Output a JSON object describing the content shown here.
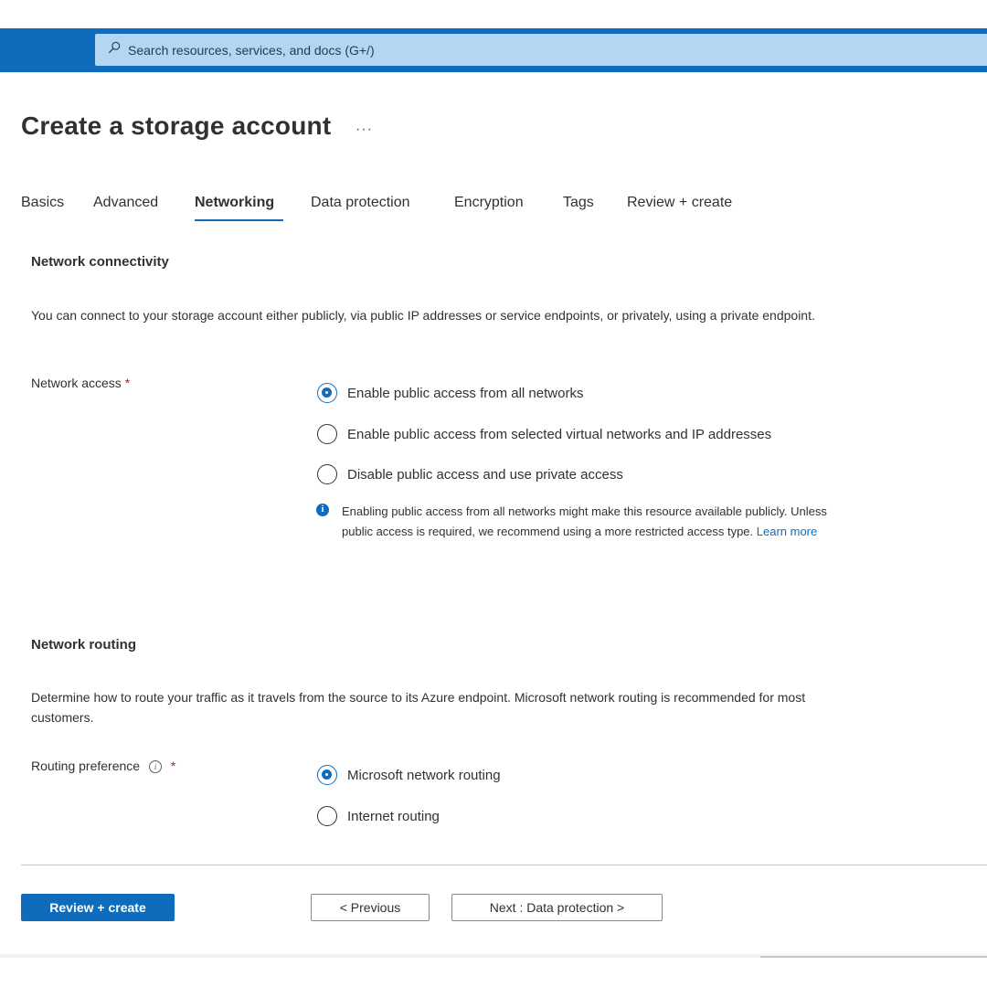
{
  "header": {
    "search_placeholder": "Search resources, services, and docs (G+/)"
  },
  "page": {
    "title": "Create a storage account",
    "more_label": "···"
  },
  "tabs": [
    {
      "label": "Basics",
      "active": false
    },
    {
      "label": "Advanced",
      "active": false
    },
    {
      "label": "Networking",
      "active": true
    },
    {
      "label": "Data protection",
      "active": false
    },
    {
      "label": "Encryption",
      "active": false
    },
    {
      "label": "Tags",
      "active": false
    },
    {
      "label": "Review + create",
      "active": false
    }
  ],
  "network_connectivity": {
    "title": "Network connectivity",
    "description": "You can connect to your storage account either publicly, via public IP addresses or service endpoints, or privately, using a private endpoint.",
    "field_label": "Network access",
    "required_mark": "*",
    "options": [
      {
        "label": "Enable public access from all networks",
        "selected": true
      },
      {
        "label": "Enable public access from selected virtual networks and IP addresses",
        "selected": false
      },
      {
        "label": "Disable public access and use private access",
        "selected": false
      }
    ],
    "info_text": "Enabling public access from all networks might make this resource available publicly. Unless public access is required, we recommend using a more restricted access type.",
    "info_link": "Learn more"
  },
  "network_routing": {
    "title": "Network routing",
    "description": "Determine how to route your traffic as it travels from the source to its Azure endpoint. Microsoft network routing is recommended for most customers.",
    "field_label": "Routing preference",
    "info_glyph": "i",
    "required_mark": "*",
    "options": [
      {
        "label": "Microsoft network routing",
        "selected": true
      },
      {
        "label": "Internet routing",
        "selected": false
      }
    ]
  },
  "footer": {
    "review_create": "Review + create",
    "previous": "< Previous",
    "next": "Next : Data protection >"
  },
  "colors": {
    "accent": "#0f6cbd",
    "search_bg": "#b3d6f2",
    "required": "#a4262c"
  }
}
